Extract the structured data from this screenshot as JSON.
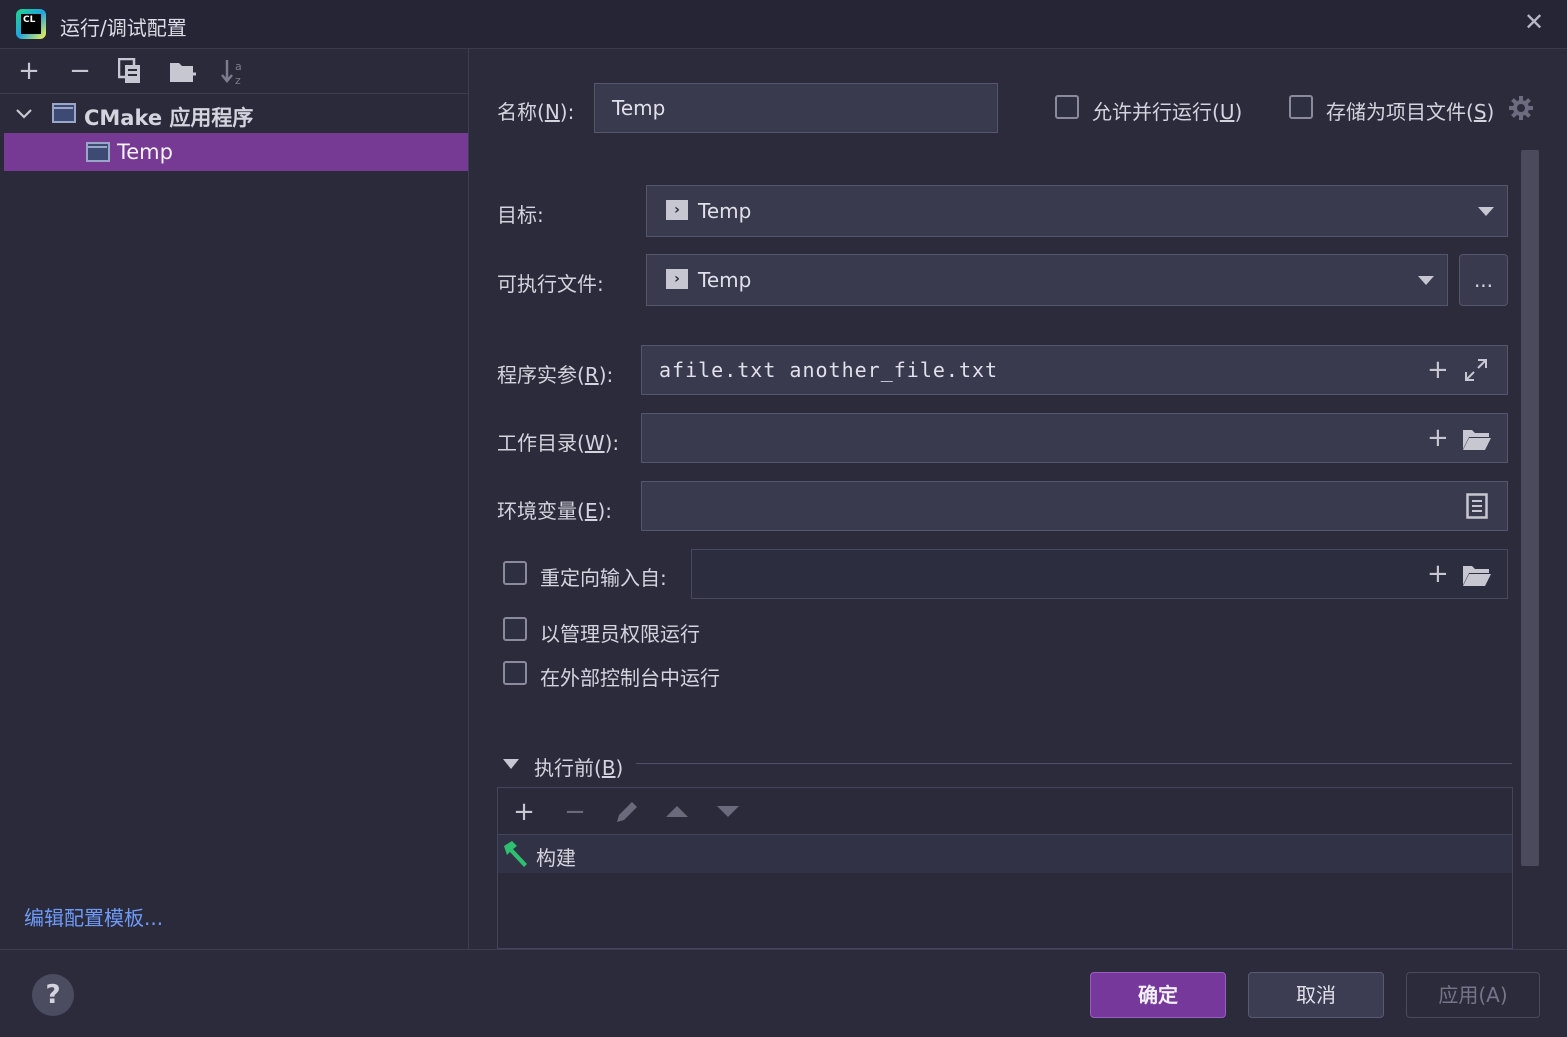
{
  "window": {
    "title": "运行/调试配置",
    "app_icon_text": "CL",
    "close_icon": "close-icon"
  },
  "left": {
    "toolbar": [
      "add-icon",
      "remove-icon",
      "copy-icon",
      "new-folder-icon",
      "sort-icon"
    ],
    "tree": {
      "group_label": "CMake 应用程序",
      "item_label": "Temp"
    },
    "edit_templates_link": "编辑配置模板..."
  },
  "form": {
    "name_label": "名称(",
    "name_mnemonic": "N",
    "name_suffix": "):",
    "name_value": "Temp",
    "allow_parallel_label": "允许并行运行(",
    "allow_parallel_mnemonic": "U",
    "allow_parallel_suffix": ")",
    "store_as_file_label": "存储为项目文件(",
    "store_as_file_mnemonic": "S",
    "store_as_file_suffix": ")",
    "target_label": "目标:",
    "target_value": "Temp",
    "executable_label": "可执行文件:",
    "executable_value": "Temp",
    "browse_label": "...",
    "program_args_label": "程序实参(",
    "program_args_mnemonic": "R",
    "program_args_suffix": "):",
    "program_args_value": "afile.txt another_file.txt",
    "workdir_label": "工作目录(",
    "workdir_mnemonic": "W",
    "workdir_suffix": "):",
    "workdir_value": "",
    "env_label": "环境变量(",
    "env_mnemonic": "E",
    "env_suffix": "):",
    "env_value": "",
    "redirect_label": "重定向输入自:",
    "redirect_value": "",
    "run_as_admin_label": "以管理员权限运行",
    "run_in_console_label": "在外部控制台中运行"
  },
  "before_launch": {
    "label": "执行前(",
    "mnemonic": "B",
    "suffix": ")",
    "toolbar": [
      "add-icon",
      "remove-icon",
      "edit-icon",
      "move-up-icon",
      "move-down-icon"
    ],
    "items": [
      {
        "label": "构建",
        "icon": "hammer-icon"
      }
    ]
  },
  "footer": {
    "help_label": "?",
    "ok_label": "确定",
    "cancel_label": "取消",
    "apply_label": "应用(A)"
  },
  "colors": {
    "selection": "#763a94",
    "link": "#6e9af7",
    "ok_button": "#76389a",
    "build_icon": "#2fbf71"
  }
}
